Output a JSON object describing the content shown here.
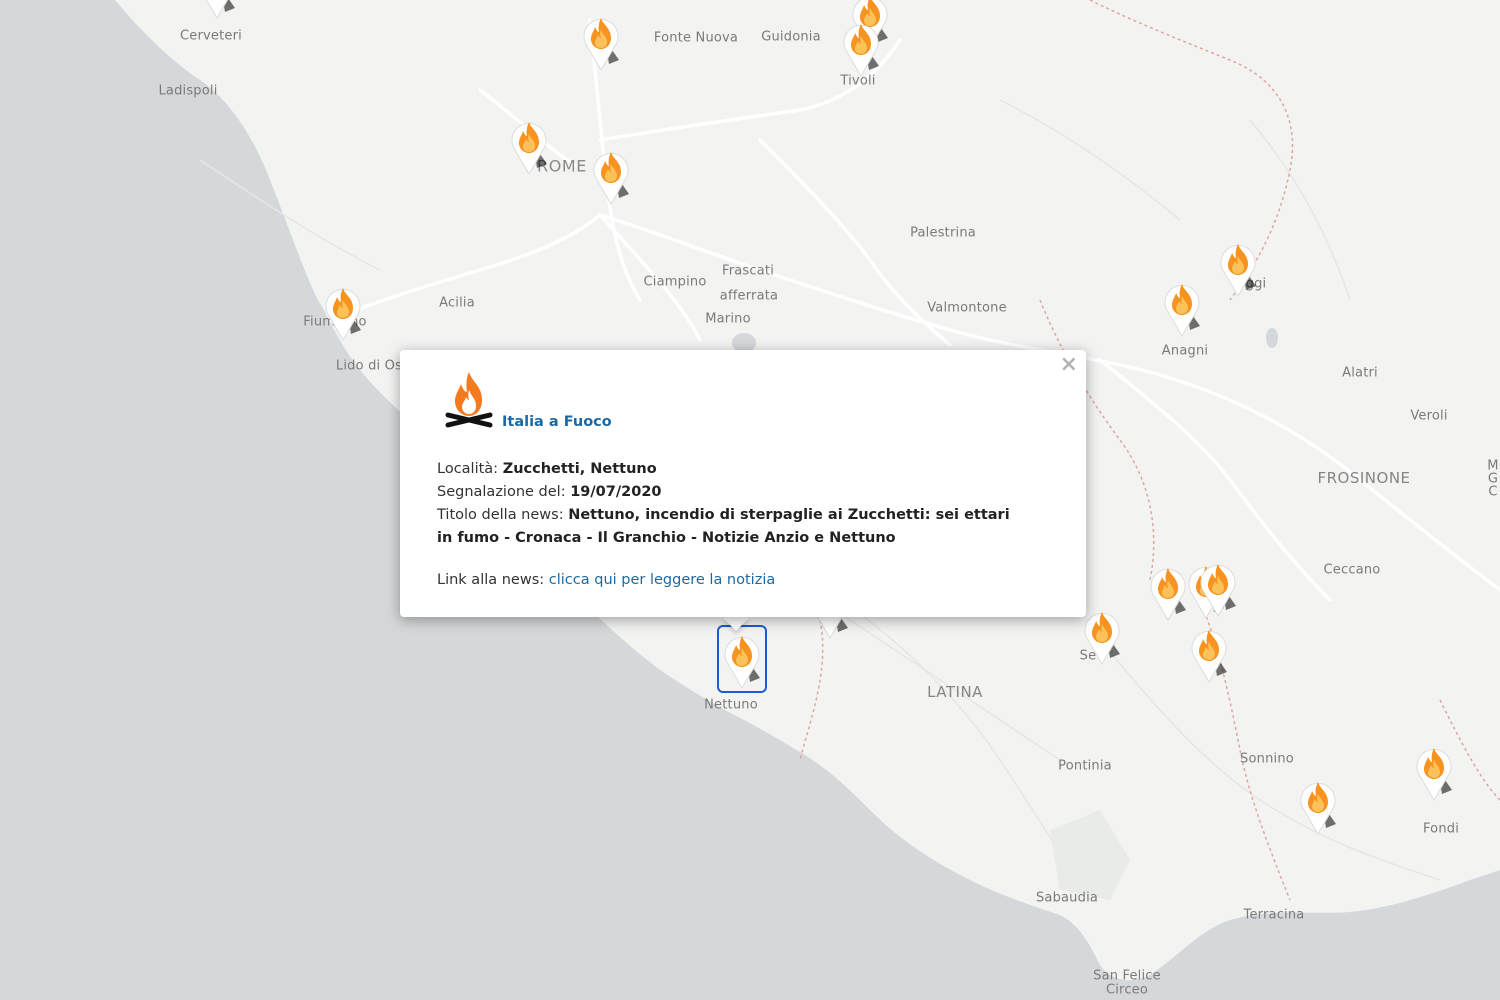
{
  "map": {
    "places": [
      {
        "name": "Cerveteri",
        "kind": "town"
      },
      {
        "name": "Ladispoli",
        "kind": "town"
      },
      {
        "name": "Fonte Nuova",
        "kind": "town"
      },
      {
        "name": "Guidonia",
        "kind": "town"
      },
      {
        "name": "Tivoli",
        "kind": "town"
      },
      {
        "name": "ROME",
        "kind": "major"
      },
      {
        "name": "Palestrina",
        "kind": "town"
      },
      {
        "name": "Frascati",
        "kind": "town"
      },
      {
        "name": "Ciampino",
        "kind": "town"
      },
      {
        "name": "afferrata",
        "kind": "town"
      },
      {
        "name": "Acilia",
        "kind": "town"
      },
      {
        "name": "Marino",
        "kind": "town"
      },
      {
        "name": "Valmontone",
        "kind": "town"
      },
      {
        "name": "Fiumicino",
        "kind": "town"
      },
      {
        "name": "Lido di Os",
        "kind": "town"
      },
      {
        "name": "Anagni",
        "kind": "town"
      },
      {
        "name": "ggi",
        "kind": "town"
      },
      {
        "name": "Alatri",
        "kind": "town"
      },
      {
        "name": "Veroli",
        "kind": "town"
      },
      {
        "name": "FROSINONE",
        "kind": "prov"
      },
      {
        "name": "Ceccano",
        "kind": "town"
      },
      {
        "name": "M",
        "kind": "town"
      },
      {
        "name": "G",
        "kind": "town"
      },
      {
        "name": "C",
        "kind": "town"
      },
      {
        "name": "LATINA",
        "kind": "prov"
      },
      {
        "name": "Nettuno",
        "kind": "town"
      },
      {
        "name": "Se",
        "kind": "town"
      },
      {
        "name": "Pontinia",
        "kind": "town"
      },
      {
        "name": "Sonnino",
        "kind": "town"
      },
      {
        "name": "Fondi",
        "kind": "town"
      },
      {
        "name": "Sabaudia",
        "kind": "town"
      },
      {
        "name": "Terracina",
        "kind": "town"
      },
      {
        "name": "San Felice",
        "kind": "town"
      },
      {
        "name": "Circeo",
        "kind": "town"
      }
    ],
    "markers_icon": "fire-marker-icon",
    "colors": {
      "sea": "#d5d8db",
      "land": "#f3f3f2",
      "road": "#ffffff",
      "border": "#dca7a1",
      "fire": "#f7931e",
      "selected_outline": "#1e5bd6"
    }
  },
  "popup": {
    "source_name": "Italia a Fuoco",
    "logo_icon": "bonfire-icon",
    "fields": [
      {
        "label": "Località: ",
        "value": "Zucchetti, Nettuno"
      },
      {
        "label": "Segnalazione del: ",
        "value": "19/07/2020"
      },
      {
        "label": "Titolo della news: ",
        "value": "Nettuno, incendio di sterpaglie ai Zucchetti: sei ettari in fumo - Cronaca - Il Granchio - Notizie Anzio e Nettuno"
      }
    ],
    "link_label": "Link alla news: ",
    "link_text": "clicca qui per leggere la notizia",
    "close_label": "×"
  }
}
